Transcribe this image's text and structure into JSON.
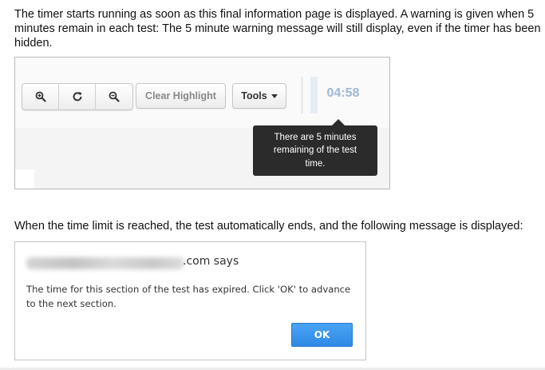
{
  "intro": {
    "lines": [
      "The timer starts running as soon as this final information page is displayed. A warning is given when 5",
      "minutes remain in each test: The 5 minute warning message will still display, even if the timer has been",
      "hidden."
    ]
  },
  "toolbar_figure": {
    "buttons": {
      "zoom_in_icon": "zoom-in",
      "reset_icon": "refresh",
      "zoom_out_icon": "zoom-out",
      "clear_highlight_label": "Clear Highlight",
      "tools_label": "Tools"
    },
    "timer": "04:58",
    "tooltip_lines": [
      "There are 5 minutes",
      "remaining of the test",
      "time."
    ],
    "colors": {
      "timer": "#9db9d6",
      "tooltip_bg": "#2b2b2b"
    }
  },
  "between_text": "When the time limit is reached, the test automatically ends, and the following message is displayed:",
  "dialog": {
    "title_suffix": ".com says",
    "message_lines": [
      "The time for this section of the test has expired.  Click 'OK' to advance",
      "to the next section."
    ],
    "ok_label": "OK",
    "colors": {
      "ok_button": "#3b95ec"
    }
  }
}
